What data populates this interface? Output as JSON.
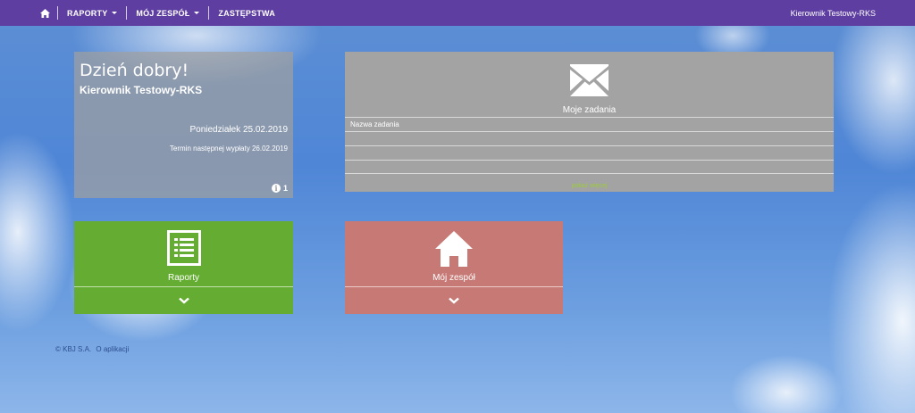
{
  "nav": {
    "home_icon": "home-icon",
    "items": [
      {
        "label": "RAPORTY",
        "dropdown": true
      },
      {
        "label": "MÓJ ZESPÓŁ",
        "dropdown": true
      },
      {
        "label": "ZASTĘPSTWA",
        "dropdown": false
      }
    ],
    "user": "Kierownik Testowy-RKS"
  },
  "welcome": {
    "greeting": "Dzień dobry!",
    "user_name": "Kierownik Testowy-RKS",
    "date": "Poniedziałek 25.02.2019",
    "next_payment": "Termin następnej wypłaty 26.02.2019",
    "info_count": "1"
  },
  "tasks": {
    "title": "Moje zadania",
    "column_header": "Nazwa zadania",
    "rows": [
      "",
      "",
      ""
    ],
    "show_more": "pokaż więcej"
  },
  "tiles": {
    "reports": {
      "label": "Raporty",
      "color": "#65ad32"
    },
    "team": {
      "label": "Mój zespół",
      "color": "#c77a75"
    }
  },
  "footer": {
    "copyright": "© KBJ S.A.",
    "about": "O aplikacji"
  },
  "colors": {
    "navbar": "#5e3ea0",
    "tasks_panel": "#a3a3a3"
  }
}
